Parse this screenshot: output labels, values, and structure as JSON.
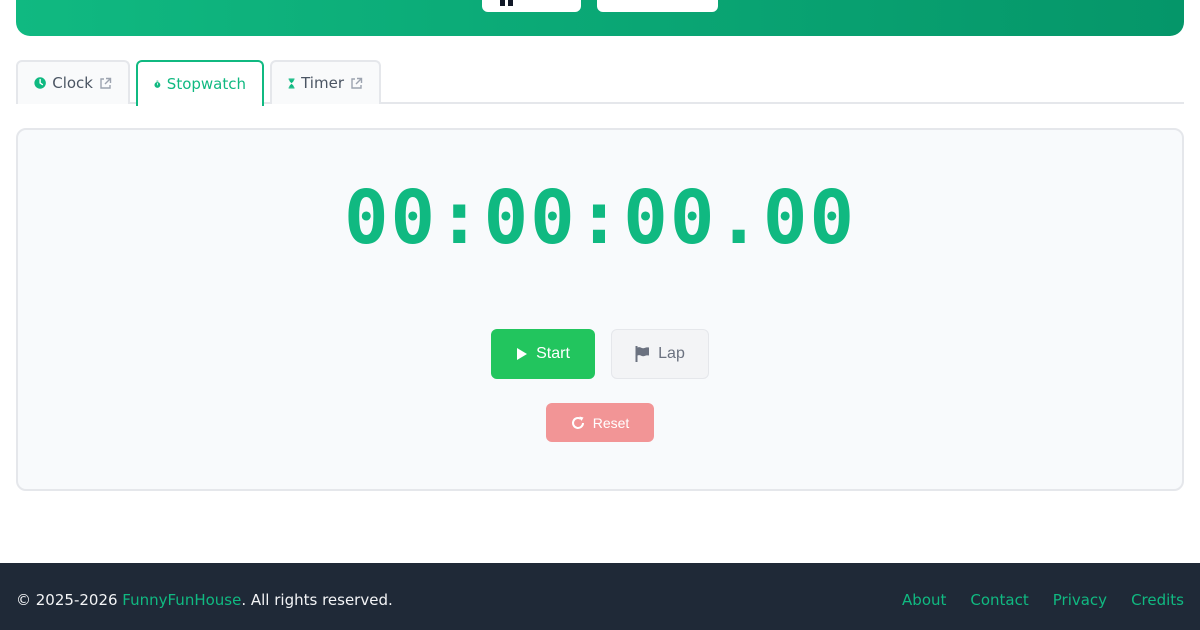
{
  "colors": {
    "accent": "#10b981",
    "start": "#22c55e",
    "reset": "#f29596",
    "footer_bg": "#1f2937"
  },
  "tabs": [
    {
      "label": "Clock",
      "icon": "clock-icon",
      "external": true
    },
    {
      "label": "Stopwatch",
      "icon": "stopwatch-icon",
      "external": false,
      "active": true
    },
    {
      "label": "Timer",
      "icon": "hourglass-icon",
      "external": true
    }
  ],
  "stopwatch": {
    "display": "00:00:00.00",
    "start_label": "Start",
    "lap_label": "Lap",
    "reset_label": "Reset"
  },
  "footer": {
    "copyright_prefix": "© 2025-2026 ",
    "brand": "FunnyFunHouse",
    "copyright_suffix": ". All rights reserved.",
    "links": [
      "About",
      "Contact",
      "Privacy",
      "Credits"
    ]
  }
}
